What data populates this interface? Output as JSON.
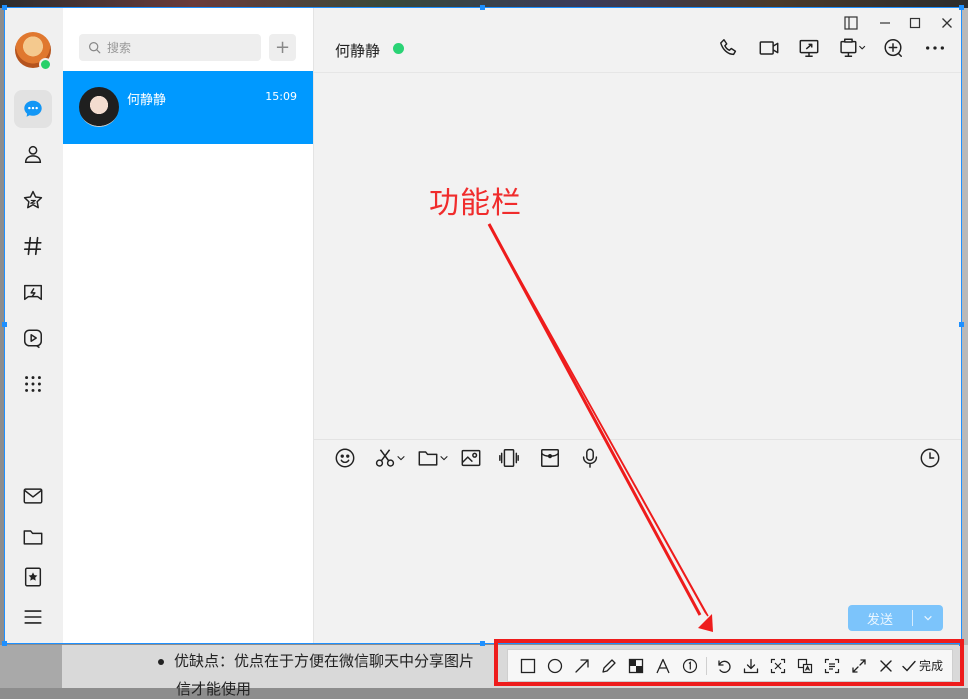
{
  "sidebar": {
    "nav_items": [
      "message-icon",
      "contacts-icon",
      "favorites-icon",
      "channels-icon",
      "game-center-icon",
      "video-icon",
      "apps-grid-icon"
    ],
    "bottom_items": [
      "mail-icon",
      "folder-icon",
      "collection-icon",
      "menu-icon"
    ]
  },
  "contact_list": {
    "search_placeholder": "搜索",
    "add_label": "+",
    "contacts": [
      {
        "name": "何静静",
        "time": "15:09"
      }
    ]
  },
  "chat": {
    "title": "何静静",
    "status_color": "#2ad375",
    "send_label": "发送"
  },
  "annotation": {
    "label": "功能栏",
    "color": "#ee1c1c"
  },
  "background_article": {
    "line1": "优缺点：优点在于方便在微信聊天中分享图片",
    "line2": "信才能使用"
  },
  "screenshot_toolbar": {
    "done_label": "完成",
    "tools": [
      "rectangle",
      "ellipse",
      "arrow",
      "pen",
      "mosaic",
      "text",
      "number",
      "undo",
      "download",
      "pin",
      "translate",
      "ocr",
      "close"
    ]
  },
  "colors": {
    "accent": "#0099ff",
    "send_button": "#7cc4fb",
    "online": "#2ad375"
  }
}
